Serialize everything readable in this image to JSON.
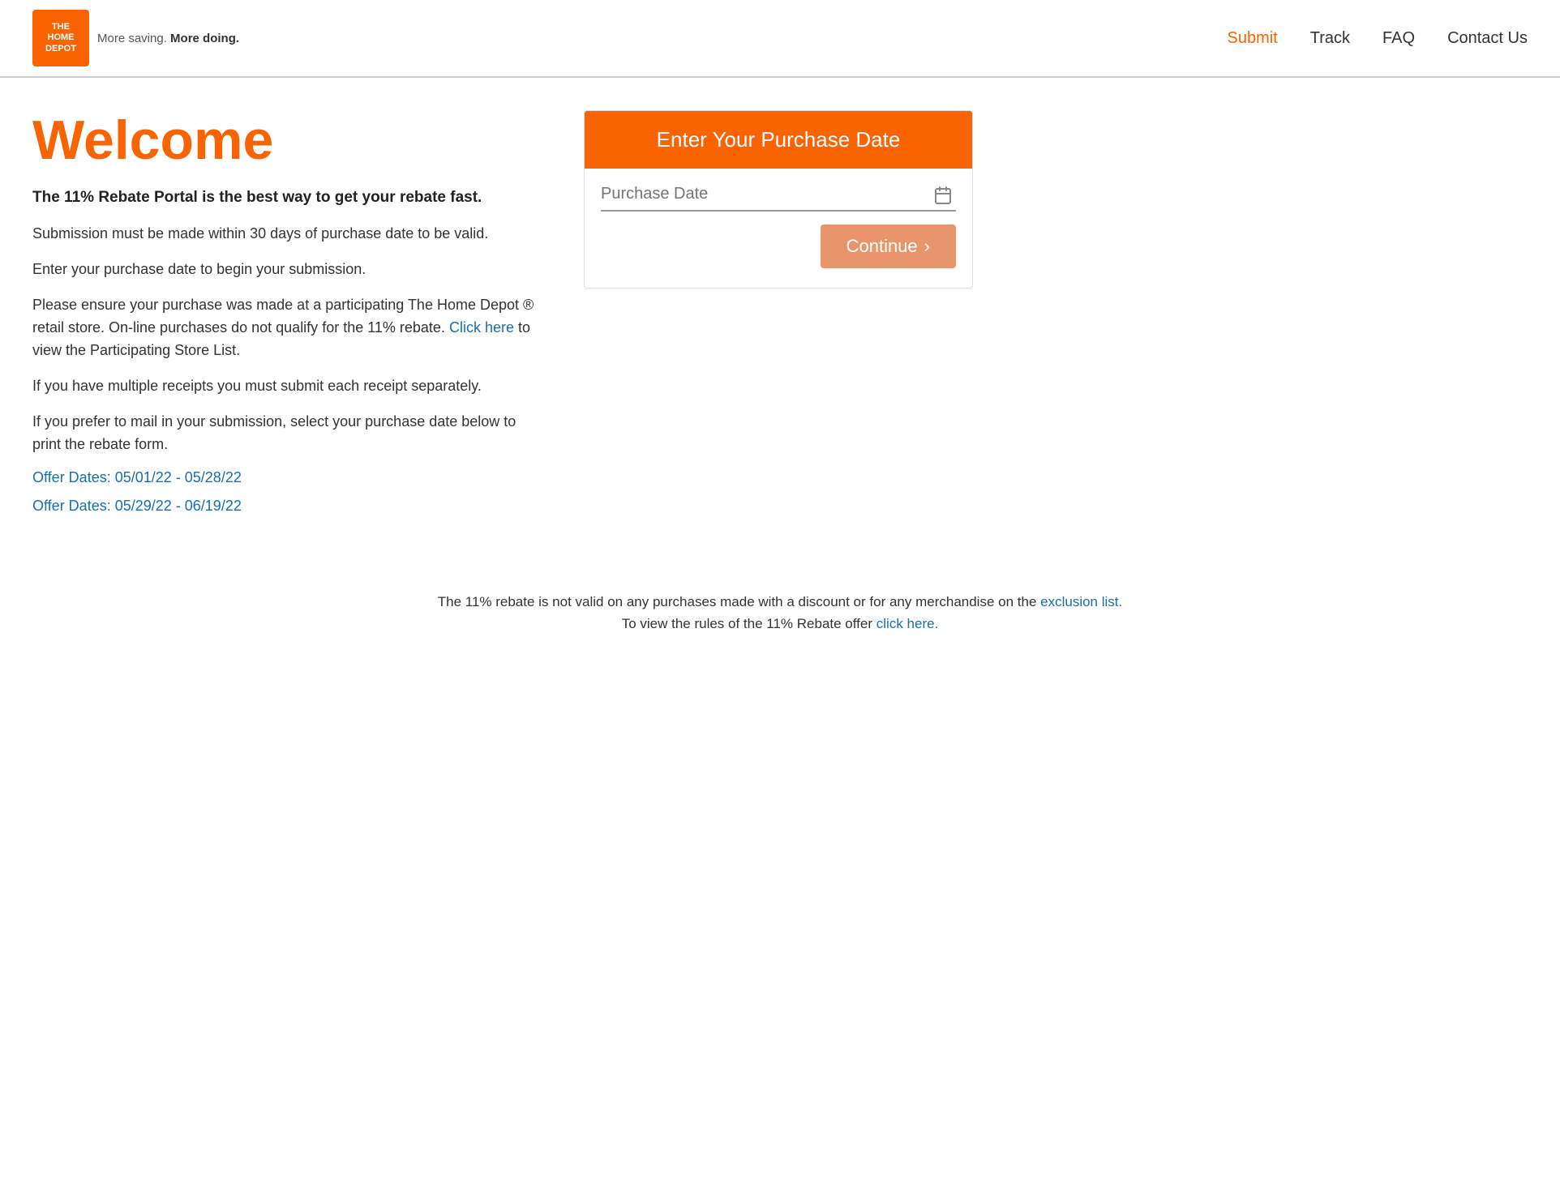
{
  "header": {
    "logo_text": "THE\nHOME\nDEPOT",
    "tagline_start": "More saving.",
    "tagline_bold": "More doing.",
    "nav": [
      {
        "id": "submit",
        "label": "Submit",
        "active": true
      },
      {
        "id": "track",
        "label": "Track",
        "active": false
      },
      {
        "id": "faq",
        "label": "FAQ",
        "active": false
      },
      {
        "id": "contact",
        "label": "Contact Us",
        "active": false
      }
    ]
  },
  "main": {
    "welcome_title": "Welcome",
    "intro_bold": "The 11% Rebate Portal is the best way to get your rebate fast.",
    "para1": "Submission must be made within 30 days of purchase date to be valid.",
    "para2": "Enter your purchase date to begin your submission.",
    "para3_before": "Please ensure your purchase was made at a participating The Home Depot ® retail store. On-line purchases do not qualify for the 11% rebate.",
    "para3_link_text": "Click here",
    "para3_after": "to view the Participating Store List.",
    "para4": "If you have multiple receipts you must submit each receipt separately.",
    "para5": "If you prefer to mail in your submission, select your purchase date below to print the rebate form.",
    "offer1": "Offer Dates: 05/01/22 - 05/28/22",
    "offer2": "Offer Dates: 05/29/22 - 06/19/22"
  },
  "form": {
    "header": "Enter Your Purchase Date",
    "date_placeholder": "Purchase Date",
    "continue_label": "Continue",
    "continue_arrow": "›"
  },
  "bottom_note": {
    "text_before": "The 11% rebate is not valid on any purchases made with a discount or for any merchandise on the",
    "exclusion_link": "exclusion list.",
    "text_middle": "To view the rules of the 11% Rebate offer",
    "click_here_link": "click here."
  },
  "colors": {
    "orange": "#f96302",
    "blue_link": "#1a6fa8",
    "btn_muted": "#e8956e"
  }
}
